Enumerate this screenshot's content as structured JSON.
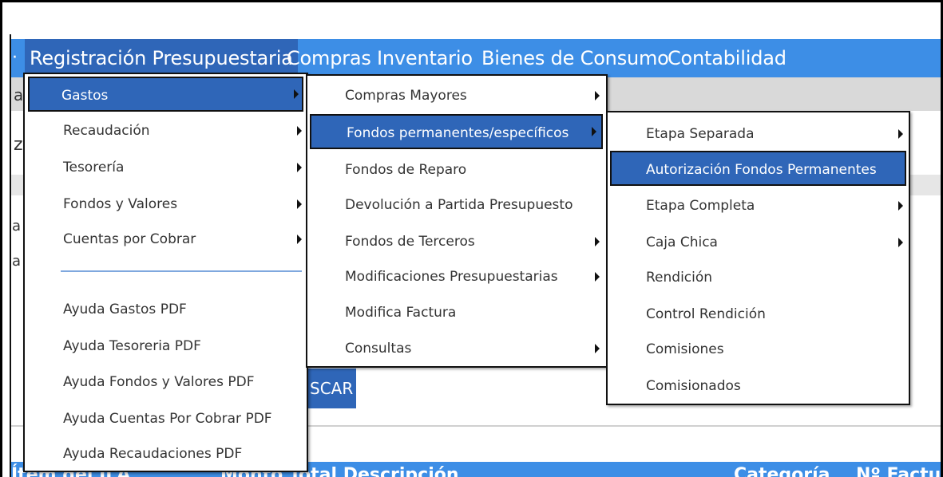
{
  "menubar": {
    "items": [
      {
        "label": "Registración Presupuestaria"
      },
      {
        "label": "Compras"
      },
      {
        "label": "Inventario"
      },
      {
        "label": "Bienes de Consumo"
      },
      {
        "label": "Contabilidad"
      }
    ]
  },
  "background": {
    "clipped_texts": [
      "a",
      "z",
      "a",
      "a"
    ],
    "buscar_label": "SCAR",
    "bottom_texts": [
      "Ítem del ILA",
      "Monto Total   Descripción",
      "Categoría",
      "Nº Factura"
    ]
  },
  "menu_level1": {
    "items": [
      {
        "label": "Gastos"
      },
      {
        "label": "Recaudación"
      },
      {
        "label": "Tesorería"
      },
      {
        "label": "Fondos y Valores"
      },
      {
        "label": "Cuentas por Cobrar"
      }
    ],
    "help_items": [
      {
        "label": "Ayuda Gastos PDF"
      },
      {
        "label": "Ayuda Tesoreria PDF"
      },
      {
        "label": "Ayuda Fondos y Valores PDF"
      },
      {
        "label": "Ayuda Cuentas Por Cobrar PDF"
      },
      {
        "label": "Ayuda Recaudaciones PDF"
      }
    ]
  },
  "menu_level2": {
    "items": [
      {
        "label": "Compras Mayores"
      },
      {
        "label": "Fondos permanentes/específicos"
      },
      {
        "label": "Fondos de Reparo"
      },
      {
        "label": "Devolución a Partida Presupuesto"
      },
      {
        "label": "Fondos de Terceros"
      },
      {
        "label": "Modificaciones Presupuestarias"
      },
      {
        "label": "Modifica Factura"
      },
      {
        "label": "Consultas"
      }
    ]
  },
  "menu_level3": {
    "items": [
      {
        "label": "Etapa Separada"
      },
      {
        "label": "Autorización Fondos Permanentes"
      },
      {
        "label": "Etapa Completa"
      },
      {
        "label": "Caja Chica"
      },
      {
        "label": "Rendición"
      },
      {
        "label": "Control Rendición"
      },
      {
        "label": "Comisiones"
      },
      {
        "label": "Comisionados"
      }
    ]
  },
  "colors": {
    "menubar": "#3d8ee6",
    "highlight": "#2f66b8"
  }
}
